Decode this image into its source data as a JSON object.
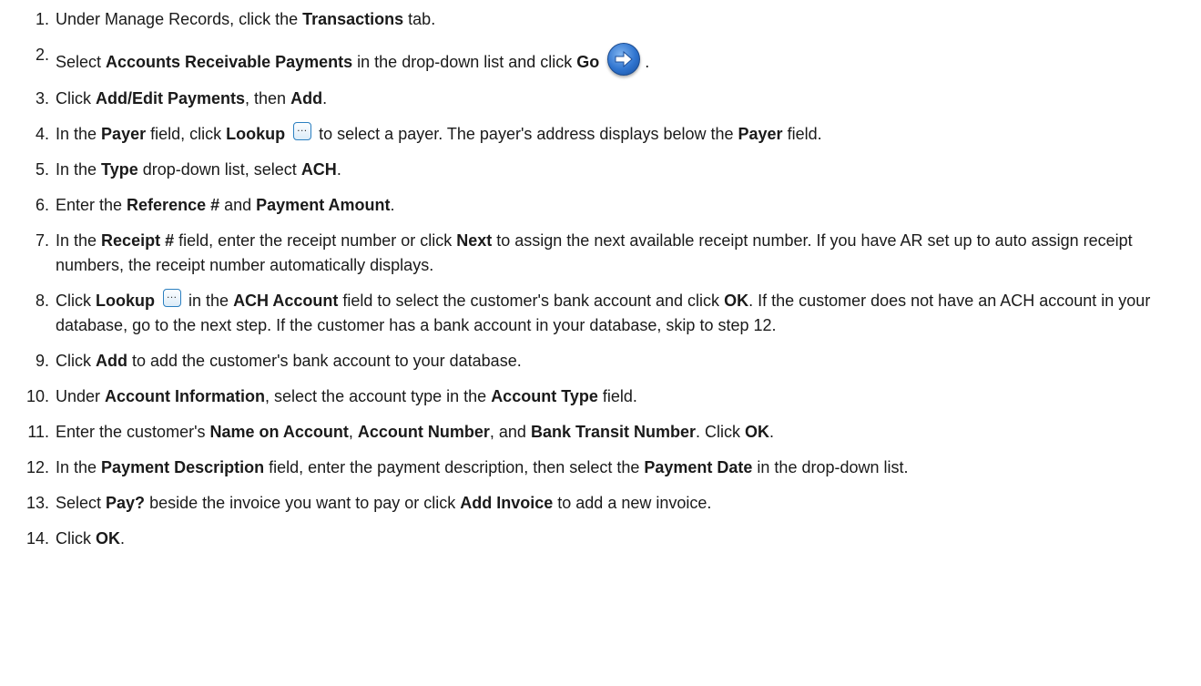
{
  "steps": [
    {
      "num": "1.",
      "parts": [
        "Under Manage Records, click the ",
        {
          "b": "Transactions"
        },
        " tab."
      ]
    },
    {
      "num": "2.",
      "parts": [
        "Select ",
        {
          "b": "Accounts Receivable Payments"
        },
        " in the drop-down list and click ",
        {
          "b": "Go"
        },
        " ",
        {
          "icon": "go-icon"
        },
        " ."
      ]
    },
    {
      "num": "3.",
      "parts": [
        "Click ",
        {
          "b": "Add/Edit Payments"
        },
        ", then ",
        {
          "b": "Add"
        },
        "."
      ]
    },
    {
      "num": "4.",
      "parts": [
        "In the ",
        {
          "b": "Payer"
        },
        " field, click ",
        {
          "b": "Lookup"
        },
        " ",
        {
          "icon": "lookup-icon"
        },
        " to select a payer. The payer's address displays below the ",
        {
          "b": "Payer"
        },
        " field."
      ]
    },
    {
      "num": "5.",
      "parts": [
        "In the ",
        {
          "b": "Type"
        },
        " drop-down list, select ",
        {
          "b": "ACH"
        },
        "."
      ]
    },
    {
      "num": "6.",
      "parts": [
        "Enter the ",
        {
          "b": "Reference #"
        },
        " and ",
        {
          "b": "Payment Amount"
        },
        "."
      ]
    },
    {
      "num": "7.",
      "parts": [
        "In the ",
        {
          "b": "Receipt #"
        },
        " field, enter the receipt number or click ",
        {
          "b": "Next"
        },
        " to assign the next available receipt number. If you have AR set up to auto assign receipt numbers, the receipt number automatically displays."
      ]
    },
    {
      "num": "8.",
      "parts": [
        "Click ",
        {
          "b": "Lookup"
        },
        " ",
        {
          "icon": "lookup-icon"
        },
        " in the ",
        {
          "b": "ACH Account"
        },
        " field to select the customer's bank account and click ",
        {
          "b": "OK"
        },
        ". If the customer does not have an ACH account in your database, go to the next step. If the customer has a bank account in your database, skip to step 12."
      ]
    },
    {
      "num": "9.",
      "parts": [
        "Click ",
        {
          "b": "Add"
        },
        " to add the customer's bank account to your database."
      ]
    },
    {
      "num": "10.",
      "parts": [
        "Under ",
        {
          "b": "Account Information"
        },
        ", select the account type in the ",
        {
          "b": "Account Type"
        },
        " field."
      ]
    },
    {
      "num": "11.",
      "parts": [
        "Enter the customer's ",
        {
          "b": "Name on Account"
        },
        ", ",
        {
          "b": "Account Number"
        },
        ", and ",
        {
          "b": "Bank Transit Number"
        },
        ". Click ",
        {
          "b": "OK"
        },
        "."
      ]
    },
    {
      "num": "12.",
      "parts": [
        "In the ",
        {
          "b": "Payment Description"
        },
        " field, enter the payment description, then select the ",
        {
          "b": "Payment Date"
        },
        " in the drop-down list."
      ]
    },
    {
      "num": "13.",
      "parts": [
        "Select ",
        {
          "b": "Pay?"
        },
        " beside the invoice you want to pay or click ",
        {
          "b": "Add Invoice"
        },
        " to add a new invoice."
      ]
    },
    {
      "num": "14.",
      "parts": [
        "Click ",
        {
          "b": "OK"
        },
        "."
      ]
    }
  ]
}
